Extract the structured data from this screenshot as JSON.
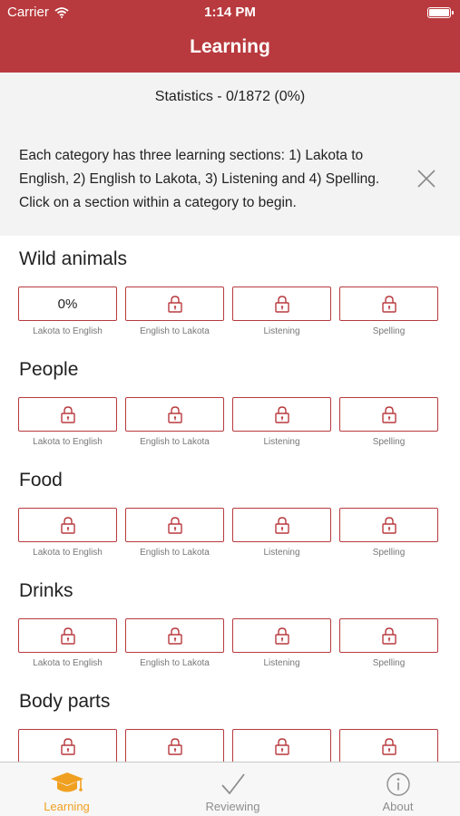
{
  "status_bar": {
    "carrier": "Carrier",
    "time": "1:14 PM",
    "wifi_icon": "wifi-icon",
    "battery_icon": "battery-icon"
  },
  "nav": {
    "title": "Learning"
  },
  "info": {
    "stats": "Statistics - 0/1872 (0%)",
    "instructions": "Each category has three learning sections: 1) Lakota to English, 2) English to Lakota, 3) Listening and 4) Spelling. Click on a section within a category to begin.",
    "close_icon": "close-icon"
  },
  "section_labels": [
    "Lakota to English",
    "English to Lakota",
    "Listening",
    "Spelling"
  ],
  "categories": [
    {
      "name": "Wild animals",
      "first_progress": "0%"
    },
    {
      "name": "People"
    },
    {
      "name": "Food"
    },
    {
      "name": "Drinks"
    },
    {
      "name": "Body parts"
    }
  ],
  "tabs": [
    {
      "label": "Learning",
      "icon": "graduation-cap-icon",
      "active": true
    },
    {
      "label": "Reviewing",
      "icon": "checkmark-icon",
      "active": false
    },
    {
      "label": "About",
      "icon": "info-icon",
      "active": false
    }
  ],
  "colors": {
    "accent": "#b83a3e",
    "active_tab": "#f0a020",
    "inactive_tab": "#8e8e8e"
  }
}
